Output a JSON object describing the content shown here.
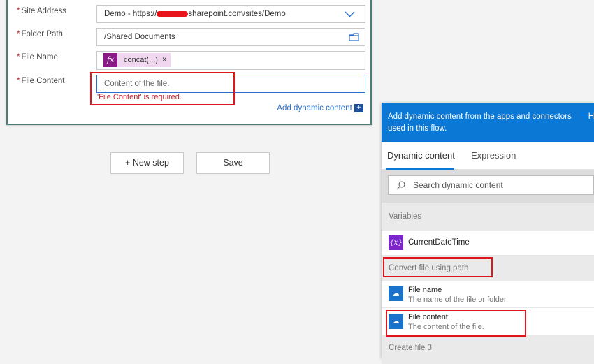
{
  "form": {
    "site_address": {
      "label": "Site Address",
      "value_prefix": "Demo - https://",
      "value_suffix": "sharepoint.com/sites/Demo"
    },
    "folder_path": {
      "label": "Folder Path",
      "value": "/Shared Documents"
    },
    "file_name": {
      "label": "File Name",
      "token": "concat(...)",
      "token_remove": "×"
    },
    "file_content": {
      "label": "File Content",
      "placeholder": "Content of the file.",
      "error": "'File Content' is required."
    },
    "required_mark": "*",
    "add_dynamic": "Add dynamic content"
  },
  "buttons": {
    "new_step": "+ New step",
    "save": "Save"
  },
  "panel": {
    "header": "Add dynamic content from the apps and connectors used in this flow.",
    "hide": "H",
    "tabs": [
      "Dynamic content",
      "Expression"
    ],
    "search_placeholder": "Search dynamic content",
    "sections": [
      {
        "title": "Variables",
        "items": [
          {
            "name": "CurrentDateTime",
            "icon": "variable-icon"
          }
        ]
      },
      {
        "title": "Convert file using path",
        "items": [
          {
            "name": "File name",
            "desc": "The name of the file or folder.",
            "icon": "onedrive-cloud-icon"
          },
          {
            "name": "File content",
            "desc": "The content of the file.",
            "icon": "onedrive-cloud-icon"
          }
        ]
      },
      {
        "title": "Create file 3",
        "items": []
      }
    ]
  },
  "colors": {
    "accent": "#0a78d4",
    "error": "#e0161f",
    "expression": "#8b1a89",
    "variable": "#7a26c8"
  }
}
